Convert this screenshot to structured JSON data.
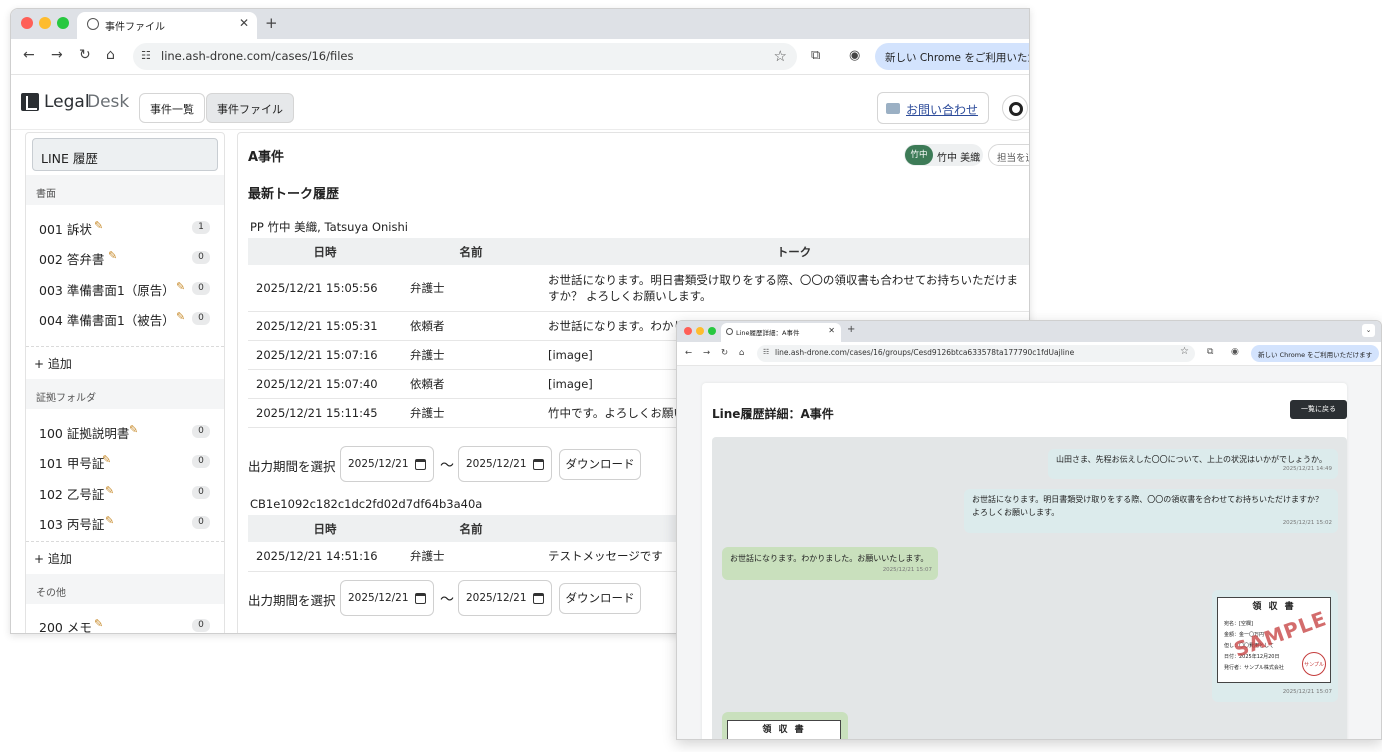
{
  "browser": {
    "tab_title": "事件ファイル",
    "url": "line.ash-drone.com/cases/16/files",
    "new_chrome": "新しい Chrome をご利用いただけ"
  },
  "app": {
    "logo_legal": "Legal",
    "logo_desk": "Desk",
    "nav": [
      "事件一覧",
      "事件ファイル"
    ],
    "contact": "お問い合わせ"
  },
  "sidebar": {
    "title": "LINE 履歴",
    "sections": [
      {
        "name": "書面",
        "items": [
          {
            "label": "001 訴状",
            "count": "1"
          },
          {
            "label": "002 答弁書",
            "count": "0"
          },
          {
            "label": "003 準備書面1（原告）",
            "count": "0"
          },
          {
            "label": "004 準備書面1（被告）",
            "count": "0"
          }
        ]
      },
      {
        "name": "証拠フォルダ",
        "items": [
          {
            "label": "100 証拠説明書",
            "count": "0"
          },
          {
            "label": "101 甲号証",
            "count": "0"
          },
          {
            "label": "102 乙号証",
            "count": "0"
          },
          {
            "label": "103 丙号証",
            "count": "0"
          }
        ]
      },
      {
        "name": "その他",
        "items": [
          {
            "label": "200 メモ",
            "count": "0"
          }
        ]
      }
    ],
    "add_label": "+ 追加"
  },
  "main": {
    "case_title": "A事件",
    "assignee_initials": "竹中",
    "assignee_name": "竹中 美織",
    "more_label": "担当を追",
    "section_title": "最新トーク履歴",
    "columns": [
      "日時",
      "名前",
      "トーク"
    ],
    "groups": [
      {
        "title": "PP 竹中 美織, Tatsuya Onishi",
        "rows": [
          {
            "date": "2025/12/21 15:05:56",
            "name": "弁護士",
            "talk": "お世話になります。明日書類受け取りをする際、〇〇の領収書も合わせてお持ちいただけますか？ よろしくお願いします。"
          },
          {
            "date": "2025/12/21 15:05:31",
            "name": "依頼者",
            "talk": "お世話になります。わかり"
          },
          {
            "date": "2025/12/21 15:07:16",
            "name": "弁護士",
            "talk": "[image]"
          },
          {
            "date": "2025/12/21 15:07:40",
            "name": "依頼者",
            "talk": "[image]"
          },
          {
            "date": "2025/12/21 15:11:45",
            "name": "弁護士",
            "talk": "竹中です。よろしくお願い"
          }
        ]
      },
      {
        "title": "CB1e1092c182c1dc2fd02d7df64b3a40a",
        "rows": [
          {
            "date": "2025/12/21 14:51:16",
            "name": "弁護士",
            "talk": "テストメッセージです"
          }
        ]
      }
    ],
    "period_label": "出力期間を選択",
    "date_from": "2025/12/21",
    "date_to": "2025/12/21",
    "tilde": "〜",
    "download_label": "ダウンロード"
  },
  "popup": {
    "tab_title": "Line履歴詳細：A事件",
    "url": "line.ash-drone.com/cases/16/groups/Cesd9126btca633578ta177790c1fdUajline",
    "new_chrome": "新しい Chrome をご利用いただけます",
    "page_title": "Line履歴詳細：A事件",
    "back_label": "一覧に戻る",
    "messages": [
      {
        "side": "out",
        "text": "山田さま、先程お伝えした〇〇について、上上の状況はいかがでしょうか。",
        "time": "2025/12/21 14:49"
      },
      {
        "side": "out",
        "text": "お世話になります。明日書類受け取りをする際、〇〇の領収書を合わせてお持ちいただけますか？ よろしくお願いします。",
        "time": "2025/12/21 15:02"
      },
      {
        "side": "in",
        "text": "お世話になります。わかりました。お願いいたします。",
        "time": "2025/12/21 15:07"
      }
    ],
    "receipt": {
      "title": "領 収 書",
      "lines": [
        "宛名：[空欄]",
        "金額：金一〇万円",
        "但し：〇〇費用として",
        "日付：2025年12月20日",
        "発行者：サンプル株式会社"
      ],
      "stamp": "サンプル",
      "watermark": "SAMPLE",
      "time": "2025/12/21 15:07"
    },
    "receipt2_title": "領 収 書"
  },
  "colors": {
    "assignee_green": "#3d7b57",
    "bubble_out": "#dcebec",
    "bubble_in": "#c9e0bd",
    "contact_link": "#2c4b9a"
  }
}
